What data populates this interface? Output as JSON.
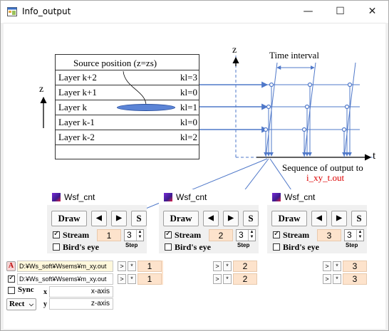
{
  "window": {
    "title": "Info_output",
    "minimize": "—",
    "maximize": "☐",
    "close": "✕"
  },
  "diagram": {
    "source_label": "Source position (z=zs)",
    "z_arrow_label": "z",
    "layers": [
      {
        "name": "Layer k+2",
        "kl": "kl=3"
      },
      {
        "name": "Layer k+1",
        "kl": "kl=0"
      },
      {
        "name": "Layer k",
        "kl": "kl=1"
      },
      {
        "name": "Layer k-1",
        "kl": "kl=0"
      },
      {
        "name": "Layer k-2",
        "kl": "kl=2"
      }
    ],
    "axis_z": "z",
    "axis_t": "t",
    "time_interval": "Time interval",
    "sequence_label": "Sequence of output to",
    "output_file": "i_xy_t.out",
    "output_color": "#dd0000"
  },
  "panels": [
    {
      "title": "Wsf_cnt",
      "draw": "Draw",
      "prev": "◀",
      "next": "▶",
      "s": "S",
      "stream": "Stream",
      "stream_value": "1",
      "step_value": "3",
      "step_label": "Step",
      "birds_eye": "Bird's eye"
    },
    {
      "title": "Wsf_cnt",
      "draw": "Draw",
      "prev": "◀",
      "next": "▶",
      "s": "S",
      "stream": "Stream",
      "stream_value": "2",
      "step_value": "3",
      "step_label": "Step",
      "birds_eye": "Bird's eye"
    },
    {
      "title": "Wsf_cnt",
      "draw": "Draw",
      "prev": "◀",
      "next": "▶",
      "s": "S",
      "stream": "Stream",
      "stream_value": "3",
      "step_value": "3",
      "step_label": "Step",
      "birds_eye": "Bird's eye"
    }
  ],
  "controls": {
    "a_label": "A",
    "path1": "D:¥Ws_soft¥Wsems¥m_xy.out",
    "path2": "D:¥Ws_soft¥Wsems¥m_xy.out",
    "gt": ">",
    "star": "*",
    "sync": "Sync",
    "x_label": "x",
    "y_label": "y",
    "x_axis": "x-axis",
    "z_axis": "z-axis",
    "rect": "Rect",
    "col1": [
      "1",
      "1"
    ],
    "col2": [
      "2",
      "2"
    ],
    "col3": [
      "3",
      "3"
    ]
  },
  "colors": {
    "arrow_blue": "#4f78c9",
    "ellipse_fill": "#5b84d6",
    "highlight_orange": "#fde3cc"
  }
}
